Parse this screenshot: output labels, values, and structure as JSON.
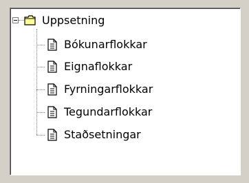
{
  "tree": {
    "root": {
      "label": "Uppsetning",
      "icon": "folder-icon",
      "expanded": true
    },
    "children": [
      {
        "label": "Bókunarflokkar",
        "icon": "document-icon"
      },
      {
        "label": "Eignaflokkar",
        "icon": "document-icon"
      },
      {
        "label": "Fyrningarflokkar",
        "icon": "document-icon"
      },
      {
        "label": "Tegundarflokkar",
        "icon": "document-icon"
      },
      {
        "label": "Staðsetningar",
        "icon": "document-icon"
      }
    ]
  },
  "colors": {
    "folder_fill": "#ffff99",
    "folder_stroke": "#000000",
    "tree_lines": "#808080",
    "window_bg": "#d4d0c8"
  }
}
